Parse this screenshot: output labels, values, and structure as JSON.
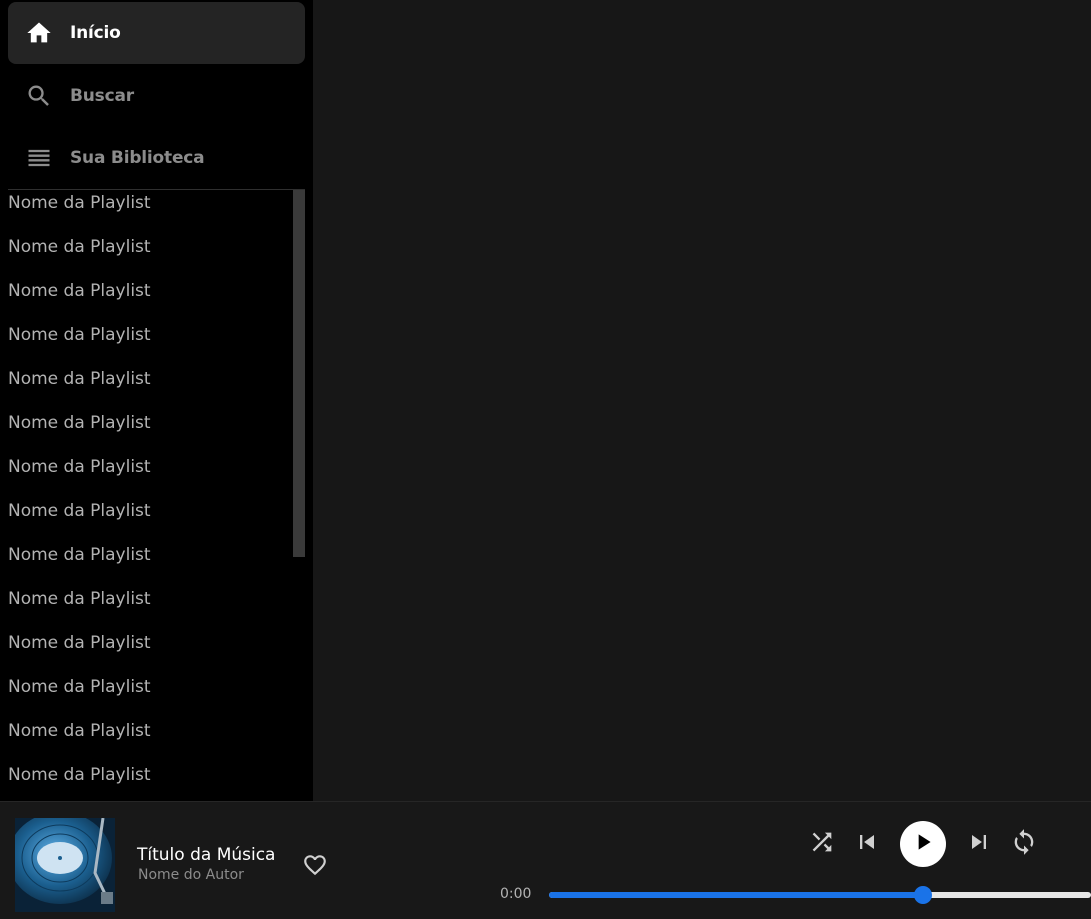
{
  "sidebar": {
    "nav": [
      {
        "label": "Início",
        "icon": "home-icon",
        "active": true
      },
      {
        "label": "Buscar",
        "icon": "search-icon",
        "active": false
      },
      {
        "label": "Sua Biblioteca",
        "icon": "library-icon",
        "active": false
      }
    ],
    "playlists": [
      "Nome da Playlist",
      "Nome da Playlist",
      "Nome da Playlist",
      "Nome da Playlist",
      "Nome da Playlist",
      "Nome da Playlist",
      "Nome da Playlist",
      "Nome da Playlist",
      "Nome da Playlist",
      "Nome da Playlist",
      "Nome da Playlist",
      "Nome da Playlist",
      "Nome da Playlist",
      "Nome da Playlist"
    ]
  },
  "player": {
    "track_title": "Título da Música",
    "track_author": "Nome do Autor",
    "current_time": "0:00",
    "progress": 0.69,
    "accent_color": "#1a73e8",
    "controls": [
      "shuffle-icon",
      "previous-icon",
      "play-icon",
      "next-icon",
      "repeat-icon"
    ]
  }
}
